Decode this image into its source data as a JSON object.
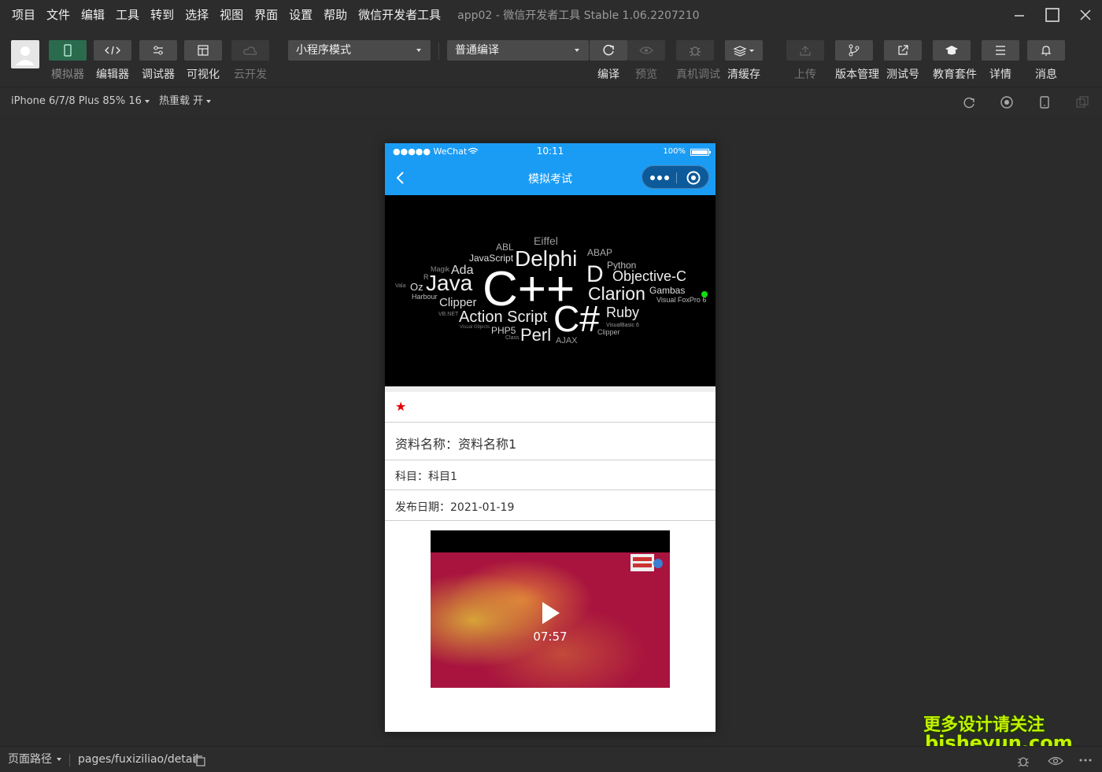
{
  "menubar": {
    "items": [
      "项目",
      "文件",
      "编辑",
      "工具",
      "转到",
      "选择",
      "视图",
      "界面",
      "设置",
      "帮助",
      "微信开发者工具"
    ],
    "app_title": "app02 - 微信开发者工具 Stable 1.06.2207210"
  },
  "toolbar": {
    "simulator": "模拟器",
    "editor": "编辑器",
    "debugger": "调试器",
    "visual": "可视化",
    "cloud": "云开发",
    "mode_select": "小程序模式",
    "compile_select": "普通编译",
    "compile": "编译",
    "preview": "预览",
    "remote_debug": "真机调试",
    "clear_cache": "清缓存",
    "upload": "上传",
    "version": "版本管理",
    "test_account": "测试号",
    "edu": "教育套件",
    "details": "详情",
    "messages": "消息"
  },
  "simbar": {
    "device": "iPhone 6/7/8 Plus 85% 16",
    "hot_reload": "热重载 开"
  },
  "phone": {
    "carrier": "●●●●● WeChat",
    "time": "10:11",
    "battery": "100%",
    "nav_title": "模拟考试",
    "banner_words": [
      "Eiffel",
      "ABL",
      "ABAP",
      "JavaScript",
      "Delphi",
      "Python",
      "Magik",
      "Ada",
      "D",
      "Objective-C",
      "Vala",
      "R",
      "Oz",
      "Java",
      "C++",
      "Clarion",
      "Gambas",
      "Harbour",
      "Clipper",
      "Visual FoxPro 6",
      "VB.NET",
      "Action Script",
      "C#",
      "Ruby",
      "Visual Objects",
      "PHP5",
      "Class",
      "Perl",
      "AJAX",
      "VisualBasic 6",
      "Clipper"
    ],
    "name_row": "资料名称：资料名称1",
    "subject_row": "科目：科目1",
    "date_row": "发布日期：2021-01-19",
    "video_duration": "07:57"
  },
  "watermark": {
    "line1": "更多设计请关注",
    "line2": "bisheyun.com"
  },
  "bottombar": {
    "path_label": "页面路径",
    "path": "pages/fuxiziliao/detail"
  }
}
